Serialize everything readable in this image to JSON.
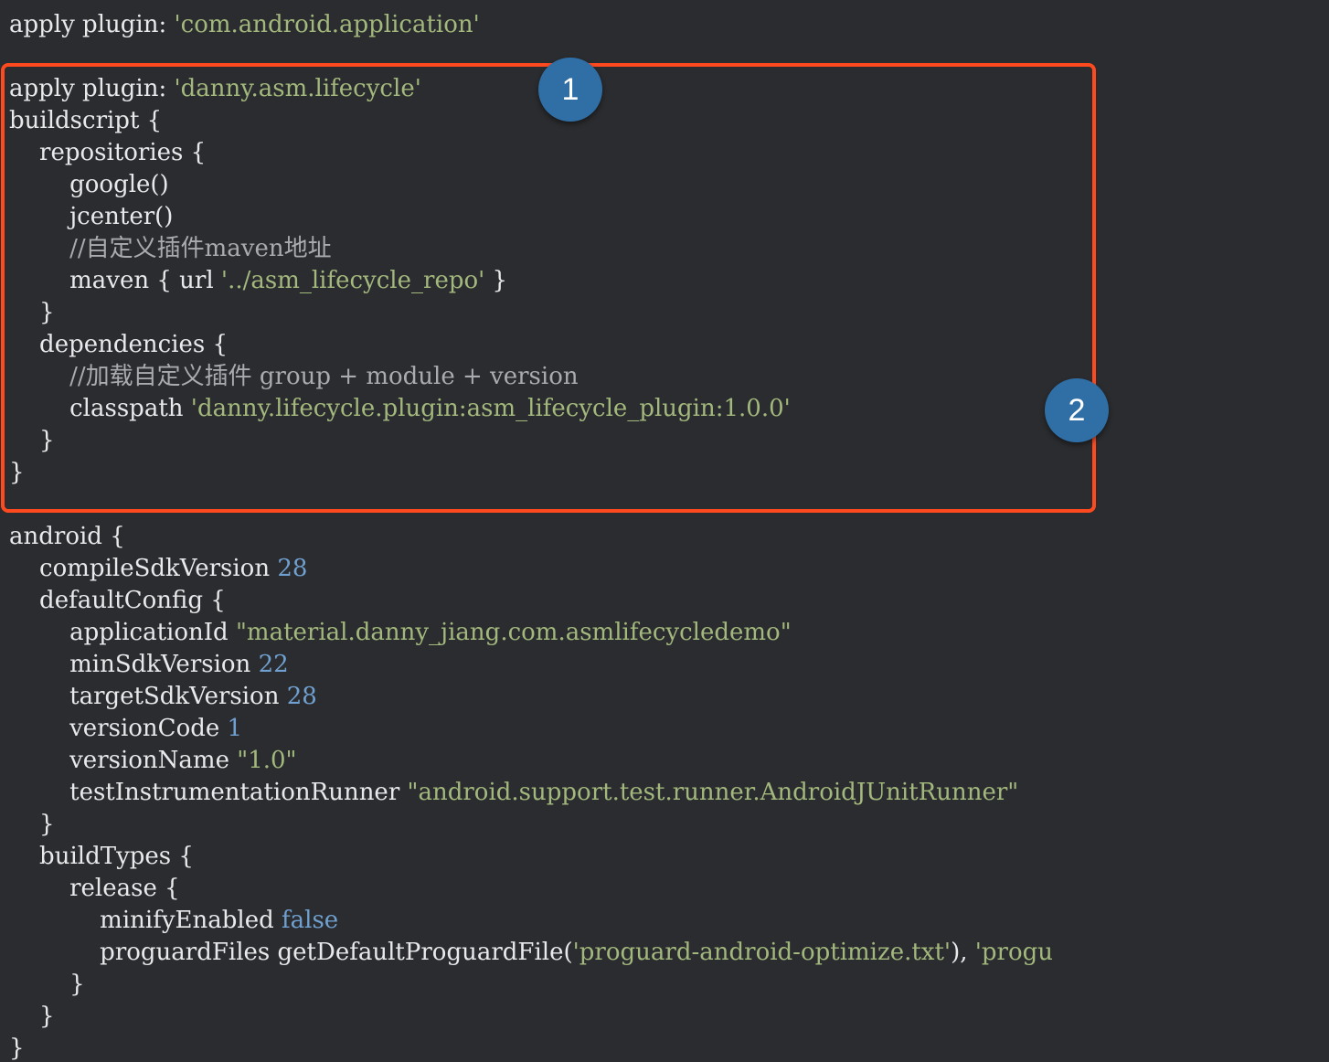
{
  "code_lines": [
    [
      {
        "t": "apply plugin: ",
        "k": "plain"
      },
      {
        "t": "'com.android.application'",
        "k": "str"
      }
    ],
    [],
    [
      {
        "t": "apply plugin: ",
        "k": "plain"
      },
      {
        "t": "'danny.asm.lifecycle'",
        "k": "str"
      }
    ],
    [
      {
        "t": "buildscript {",
        "k": "plain"
      }
    ],
    [
      {
        "t": "    repositories {",
        "k": "plain"
      }
    ],
    [
      {
        "t": "        google()",
        "k": "plain"
      }
    ],
    [
      {
        "t": "        jcenter()",
        "k": "plain"
      }
    ],
    [
      {
        "t": "        //自定义插件maven地址",
        "k": "cmt"
      }
    ],
    [
      {
        "t": "        maven { url ",
        "k": "plain"
      },
      {
        "t": "'../asm_lifecycle_repo'",
        "k": "str"
      },
      {
        "t": " }",
        "k": "plain"
      }
    ],
    [
      {
        "t": "    }",
        "k": "plain"
      }
    ],
    [
      {
        "t": "    dependencies {",
        "k": "plain"
      }
    ],
    [
      {
        "t": "        //加载自定义插件 group + module + version",
        "k": "cmt"
      }
    ],
    [
      {
        "t": "        classpath ",
        "k": "plain"
      },
      {
        "t": "'danny.lifecycle.plugin:asm_lifecycle_plugin:1.0.0'",
        "k": "str"
      }
    ],
    [
      {
        "t": "    }",
        "k": "plain"
      }
    ],
    [
      {
        "t": "}",
        "k": "plain"
      }
    ],
    [],
    [
      {
        "t": "android {",
        "k": "plain"
      }
    ],
    [
      {
        "t": "    compileSdkVersion ",
        "k": "plain"
      },
      {
        "t": "28",
        "k": "num"
      }
    ],
    [
      {
        "t": "    defaultConfig {",
        "k": "plain"
      }
    ],
    [
      {
        "t": "        applicationId ",
        "k": "plain"
      },
      {
        "t": "\"material.danny_jiang.com.asmlifecycledemo\"",
        "k": "str"
      }
    ],
    [
      {
        "t": "        minSdkVersion ",
        "k": "plain"
      },
      {
        "t": "22",
        "k": "num"
      }
    ],
    [
      {
        "t": "        targetSdkVersion ",
        "k": "plain"
      },
      {
        "t": "28",
        "k": "num"
      }
    ],
    [
      {
        "t": "        versionCode ",
        "k": "plain"
      },
      {
        "t": "1",
        "k": "num"
      }
    ],
    [
      {
        "t": "        versionName ",
        "k": "plain"
      },
      {
        "t": "\"1.0\"",
        "k": "str"
      }
    ],
    [
      {
        "t": "        testInstrumentationRunner ",
        "k": "plain"
      },
      {
        "t": "\"android.support.test.runner.AndroidJUnitRunner\"",
        "k": "str"
      }
    ],
    [
      {
        "t": "    }",
        "k": "plain"
      }
    ],
    [
      {
        "t": "    buildTypes {",
        "k": "plain"
      }
    ],
    [
      {
        "t": "        release {",
        "k": "plain"
      }
    ],
    [
      {
        "t": "            minifyEnabled ",
        "k": "plain"
      },
      {
        "t": "false",
        "k": "kw"
      }
    ],
    [
      {
        "t": "            proguardFiles getDefaultProguardFile(",
        "k": "plain"
      },
      {
        "t": "'proguard-android-optimize.txt'",
        "k": "str"
      },
      {
        "t": "), ",
        "k": "plain"
      },
      {
        "t": "'progu",
        "k": "str"
      }
    ],
    [
      {
        "t": "        }",
        "k": "plain"
      }
    ],
    [
      {
        "t": "    }",
        "k": "plain"
      }
    ],
    [
      {
        "t": "}",
        "k": "plain"
      }
    ]
  ],
  "annotations": {
    "badge_1": "1",
    "badge_2": "2"
  },
  "colors": {
    "background": "#2b2c2f",
    "text": "#e8e9ea",
    "string": "#a3b87c",
    "number": "#6fa0d0",
    "comment": "#a9abaf",
    "highlight_border": "#ff4a1f",
    "badge": "#2f6fa6"
  }
}
